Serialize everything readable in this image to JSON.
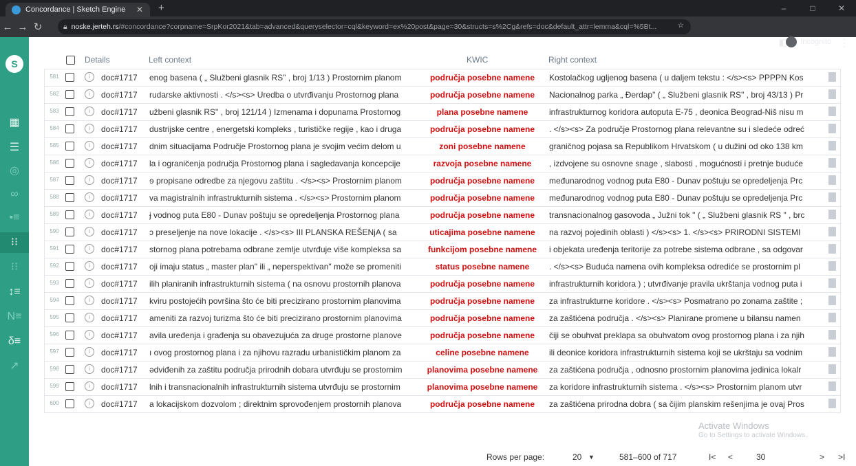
{
  "browser": {
    "tab_title": "Concordance | Sketch Engine",
    "url_host": "noske.jerteh.rs",
    "url_rest": "/#concordance?corpname=SrpKor2021&tab=advanced&queryselector=cql&keyword=ex%20post&page=30&structs=s%2Cg&refs=doc&default_attr=lemma&cql=%5Bt...",
    "profile": "Incognito"
  },
  "table": {
    "headers": {
      "details": "Details",
      "left": "Left context",
      "kwic": "KWIC",
      "right": "Right context"
    },
    "rows": [
      {
        "num": "581",
        "doc": "doc#1717",
        "left": "enog basena ( „ Službeni glasnik RS\" , broj 1/13 ) Prostornim planom",
        "kwic": "područja posebne namene",
        "right": "Kostolačkog ugljenog basena ( u daljem tekstu : </s><s> PPPPN Kos"
      },
      {
        "num": "582",
        "doc": "doc#1717",
        "left": "rudarske aktivnosti . </s><s> Uredba o utvrđivanju Prostornog plana",
        "kwic": "područja posebne namene",
        "right": "Nacionalnog parka „ Đerdap\" ( „ Službeni glasnik RS\" , broj 43/13 ) Pr"
      },
      {
        "num": "583",
        "doc": "doc#1717",
        "left": "užbeni glasnik RS\" , broj 121/14 ) Izmenama i dopunama Prostornog",
        "kwic": "plana posebne namene",
        "right": "infrastrukturnog koridora autoputa E-75 , deonica Beograd-Niš nisu m"
      },
      {
        "num": "584",
        "doc": "doc#1717",
        "left": "dustrijske centre , energetski kompleks , turističke regije , kao i druga",
        "kwic": "područja posebne namene",
        "right": ". </s><s> Za područje Prostornog plana relevantne su i sledeće odreć"
      },
      {
        "num": "585",
        "doc": "doc#1717",
        "left": "dnim situacijama Područje Prostornog plana je svojim većim delom u",
        "kwic": "zoni posebne namene",
        "right": "graničnog pojasa sa Republikom Hrvatskom ( u dužini od oko 138 km"
      },
      {
        "num": "586",
        "doc": "doc#1717",
        "left": "la i ograničenja područja Prostornog plana i sagledavanja koncepcije",
        "kwic": "razvoja posebne namene",
        "right": ", izdvojene su osnovne snage , slabosti , mogućnosti i pretnje buduće"
      },
      {
        "num": "587",
        "doc": "doc#1717",
        "left": "ɘ propisane odredbe za njegovu zaštitu . </s><s> Prostornim planom",
        "kwic": "područja posebne namene",
        "right": "međunarodnog vodnog puta E80 - Dunav poštuju se opredeljenja Prc"
      },
      {
        "num": "588",
        "doc": "doc#1717",
        "left": "va magistralnih infrastrukturnih sistema . </s><s> Prostornim planom",
        "kwic": "područja posebne namene",
        "right": "međunarodnog vodnog puta E80 - Dunav poštuju se opredeljenja Prc"
      },
      {
        "num": "589",
        "doc": "doc#1717",
        "left": "ɉ vodnog puta E80 - Dunav poštuju se opredeljenja Prostornog plana",
        "kwic": "područja posebne namene",
        "right": "transnacionalnog gasovoda „ Južni tok \" ( „ Službeni glasnik RS \" , brc"
      },
      {
        "num": "590",
        "doc": "doc#1717",
        "left": "ɔ preseljenje na nove lokacije . </s><s> III PLANSKA REŠENjA ( sa",
        "kwic": "uticajima posebne namene",
        "right": "na razvoj pojedinih oblasti ) </s><s> 1. </s><s> PRIRODNI SISTEMI"
      },
      {
        "num": "591",
        "doc": "doc#1717",
        "left": "stornog plana potrebama odbrane zemlje utvrđuje više kompleksa sa",
        "kwic": "funkcijom posebne namene",
        "right": "i objekata uređenja teritorije za potrebe sistema odbrane , sa odgovar"
      },
      {
        "num": "592",
        "doc": "doc#1717",
        "left": "oji imaju status „ master plan\" ili „ neperspektivan\" može se promeniti",
        "kwic": "status posebne namene",
        "right": ". </s><s> Buduća namena ovih kompleksa odrediće se prostornim pl"
      },
      {
        "num": "593",
        "doc": "doc#1717",
        "left": "ilih planiranih infrastrukturnih sistema ( na osnovu prostornih planova",
        "kwic": "područja posebne namene",
        "right": "infrastrukturnih koridora ) ; utvrđivanje pravila ukrštanja vodnog puta i"
      },
      {
        "num": "594",
        "doc": "doc#1717",
        "left": "kviru postojećih površina što će biti precizirano prostornim planovima",
        "kwic": "područja posebne namene",
        "right": "za infrastrukturne koridore . </s><s> Posmatrano po zonama zaštite ;"
      },
      {
        "num": "595",
        "doc": "doc#1717",
        "left": "ameniti za razvoj turizma što će biti precizirano prostornim planovima",
        "kwic": "područja posebne namene",
        "right": "za zaštićena područja . </s><s> Planirane promene u bilansu namen"
      },
      {
        "num": "596",
        "doc": "doc#1717",
        "left": "avila uređenja i građenja su obavezujuća za druge prostorne planove",
        "kwic": "područja posebne namene",
        "right": "čiji se obuhvat preklapa sa obuhvatom ovog prostornog plana i za njih"
      },
      {
        "num": "597",
        "doc": "doc#1717",
        "left": "ı ovog prostornog plana i za njihovu razradu urbanističkim planom za",
        "kwic": "celine posebne namene",
        "right": "ili deonice koridora infrastrukturnih sistema koji se ukrštaju sa vodnim"
      },
      {
        "num": "598",
        "doc": "doc#1717",
        "left": "ədviđenih za zaštitu područja prirodnih dobara utvrđuju se prostornim",
        "kwic": "planovima posebne namene",
        "right": "za zaštićena područja , odnosno prostornim planovima jedinica lokalr"
      },
      {
        "num": "599",
        "doc": "doc#1717",
        "left": "lnih i transnacionalnih infrastrukturnih sistema utvrđuju se prostornim",
        "kwic": "planovima posebne namene",
        "right": "za koridore infrastrukturnih sistema . </s><s> Prostornim planom utvr"
      },
      {
        "num": "600",
        "doc": "doc#1717",
        "left": "a lokacijskom dozvolom ; direktnim sprovođenjem prostornih planova",
        "kwic": "područja posebne namene",
        "right": "za zaštićena prirodna dobra ( sa čijim planskim rešenjima je ovaj Pros"
      }
    ]
  },
  "footer": {
    "rows_label": "Rows per page:",
    "rows_value": "20",
    "range": "581–600 of 717",
    "first": "I<",
    "prev": "<",
    "page": "30",
    "next": ">",
    "last": ">I"
  },
  "watermark": {
    "line1": "Activate Windows",
    "line2": "Go to Settings to activate Windows."
  }
}
